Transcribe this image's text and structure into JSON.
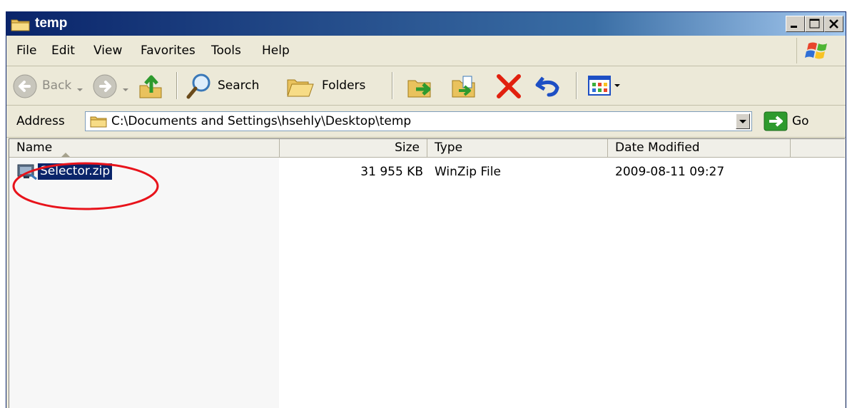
{
  "window": {
    "title": "temp"
  },
  "menubar": {
    "file": "File",
    "edit": "Edit",
    "view": "View",
    "favorites": "Favorites",
    "tools": "Tools",
    "help": "Help"
  },
  "toolbar": {
    "back": "Back",
    "search": "Search",
    "folders": "Folders"
  },
  "address": {
    "label": "Address",
    "path": "C:\\Documents and Settings\\hsehly\\Desktop\\temp",
    "go": "Go"
  },
  "list": {
    "columns": {
      "name": "Name",
      "size": "Size",
      "type": "Type",
      "date": "Date Modified"
    },
    "rows": [
      {
        "name": "Selector.zip",
        "size": "31 955 KB",
        "type": "WinZip File",
        "date": "2009-08-11 09:27"
      }
    ]
  },
  "colors": {
    "titlebar": "#0a246a",
    "selection": "#0a246a",
    "annotation": "#e8131b"
  }
}
